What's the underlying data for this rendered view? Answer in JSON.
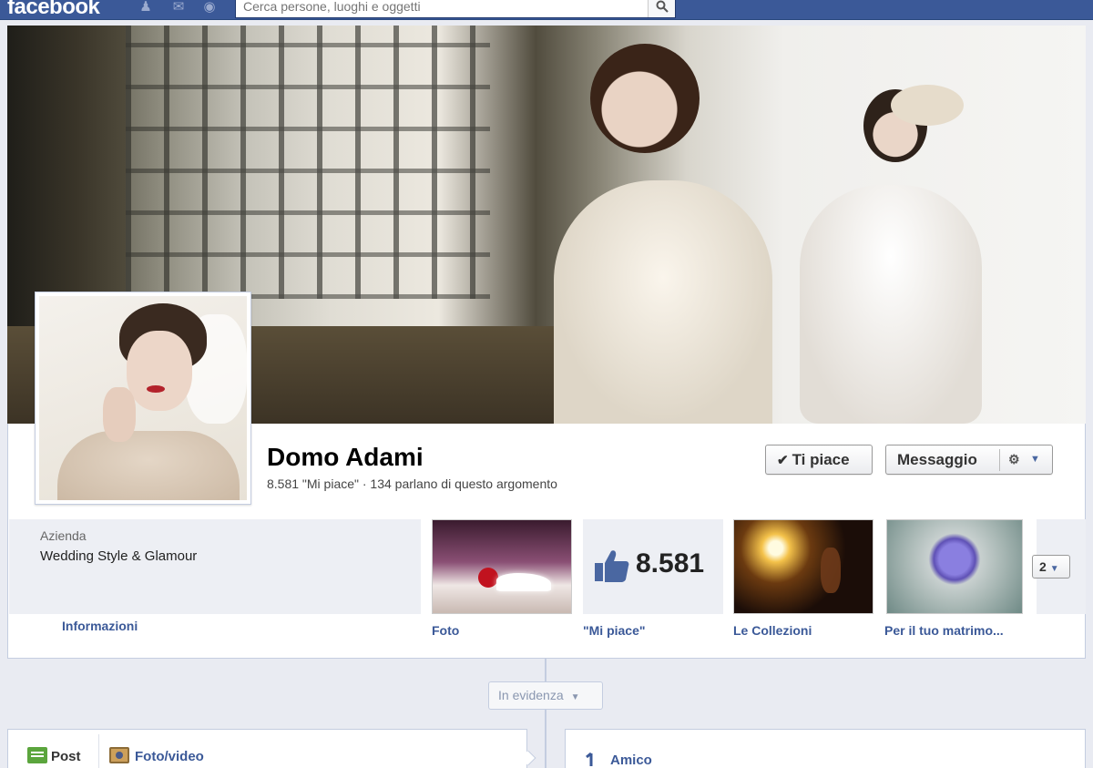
{
  "topbar": {
    "logo": "facebook",
    "search_placeholder": "Cerca persone, luoghi e oggetti",
    "brand_color": "#3b5998",
    "icons": [
      "friend-requests-icon",
      "messages-icon",
      "notifications-icon",
      "search-icon"
    ]
  },
  "page": {
    "name": "Domo Adami",
    "stats": "8.581 \"Mi piace\" · 134 parlano di questo argomento",
    "like_button": "Ti piace",
    "message_button": "Messaggio"
  },
  "about": {
    "category": "Azienda",
    "description": "Wedding Style & Glamour",
    "info_link": "Informazioni"
  },
  "apps": [
    {
      "label": "Foto",
      "icon": "photo-thumbnail"
    },
    {
      "label": "\"Mi piace\"",
      "count": "8.581",
      "icon": "thumbs-up-icon"
    },
    {
      "label": "Le Collezioni",
      "icon": "collections-thumbnail"
    },
    {
      "label": "Per il tuo matrimo...",
      "icon": "wedding-thumbnail"
    }
  ],
  "more_apps_count": "2",
  "timeline": {
    "highlight_selector": "In evidenza",
    "composer_tabs": [
      "Post",
      "Foto/video"
    ],
    "friend_label": "Amico"
  }
}
